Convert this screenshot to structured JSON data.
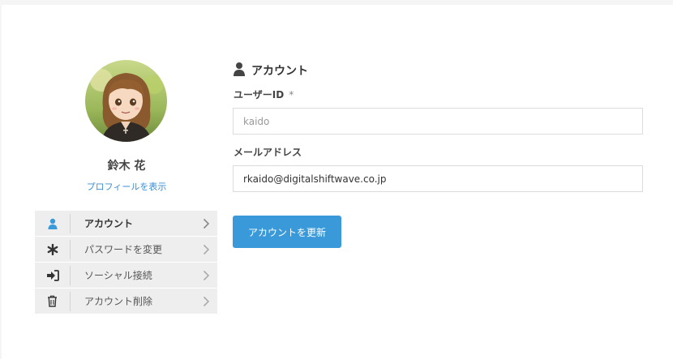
{
  "profile": {
    "name": "鈴木 花",
    "view_profile_link": "プロフィールを表示"
  },
  "menu": {
    "items": [
      {
        "label": "アカウント",
        "icon": "user-icon",
        "active": true
      },
      {
        "label": "パスワードを変更",
        "icon": "asterisk-icon",
        "active": false
      },
      {
        "label": "ソーシャル接続",
        "icon": "sign-in-icon",
        "active": false
      },
      {
        "label": "アカウント削除",
        "icon": "trash-icon",
        "active": false
      }
    ]
  },
  "form": {
    "title": "アカウント",
    "user_id_label": "ユーザーID",
    "required_mark": "*",
    "user_id_value": "kaido",
    "email_label": "メールアドレス",
    "email_value": "rkaido@digitalshiftwave.co.jp",
    "submit_label": "アカウントを更新"
  },
  "colors": {
    "accent": "#3a9ad9",
    "link": "#3a8fd0",
    "menu_bg": "#eeeeee"
  }
}
